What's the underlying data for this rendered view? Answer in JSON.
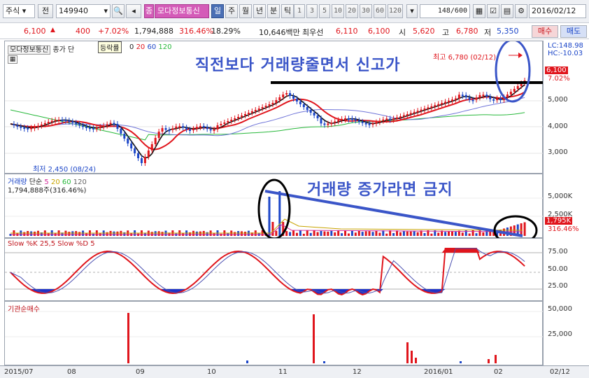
{
  "toolbar": {
    "market_type": "주식",
    "prefix_button": "전",
    "stock_code": "149940",
    "kind_badge": "종",
    "stock_name": "모다정보통신",
    "periods": [
      "일",
      "주",
      "월",
      "년",
      "분",
      "틱"
    ],
    "selected_period": "일",
    "intervals": [
      "1",
      "3",
      "5",
      "10",
      "20",
      "30",
      "60",
      "120"
    ],
    "page_counter": "148/600",
    "date": "2016/02/12"
  },
  "pricebar": {
    "price": "6,100",
    "change": "400",
    "change_rate": "+7.02%",
    "volume": "1,794,888",
    "volume_rate": "316.46%",
    "turnover": "18.29%",
    "amount": "10,646백만",
    "best_ask_label": "최우선",
    "best_ask": "6,110",
    "best_bid": "6,100",
    "open_label": "시",
    "open": "5,620",
    "high_label": "고",
    "high": "6,780",
    "low_label": "저",
    "low": "5,350",
    "buy_button": "매수",
    "sell_button": "매도"
  },
  "price_pane": {
    "legend_name": "모다정보통신",
    "legend_ma_label": "종가 단",
    "tooltip": "등락률",
    "ma_periods": [
      "0",
      "20",
      "60",
      "120"
    ],
    "high_annotation": "최고 6,780 (02/12)",
    "low_annotation": "최저 2,450 (08/24)",
    "lc_label": "LC:148.98",
    "hc_label": "HC:-10.03",
    "current_price_tag": "6,100",
    "current_rate_tag": "7.02%",
    "y_ticks": [
      "5,000",
      "4,000",
      "3,000"
    ],
    "overlay_title": "직전보다 거래량줄면서 신고가"
  },
  "volume_pane": {
    "legend_parts": [
      "거래량",
      "단순",
      "5",
      "20",
      "60",
      "120"
    ],
    "legend_value": "1,794,888주(316.46%)",
    "y_ticks": [
      "5,000K",
      "2,500K"
    ],
    "current_tag": "1,795K",
    "current_rate": "316.46%",
    "overlay_title": "거래량 증가라면 금지"
  },
  "stoch_pane": {
    "legend": "Slow %K 25,5  Slow %D 5",
    "y_ticks": [
      "75.00",
      "50.00",
      "25.00"
    ]
  },
  "inst_pane": {
    "legend": "기관순매수",
    "y_ticks": [
      "50,000",
      "25,000"
    ]
  },
  "xaxis": {
    "labels": [
      "2015/07",
      "08",
      "09",
      "10",
      "11",
      "12",
      "2016/01",
      "02"
    ],
    "right_label": "02/12"
  },
  "colors": {
    "up": "#e0151c",
    "down": "#1c46c8",
    "annotation_blue": "#3a55c8",
    "ma_green": "#27b83a"
  }
}
